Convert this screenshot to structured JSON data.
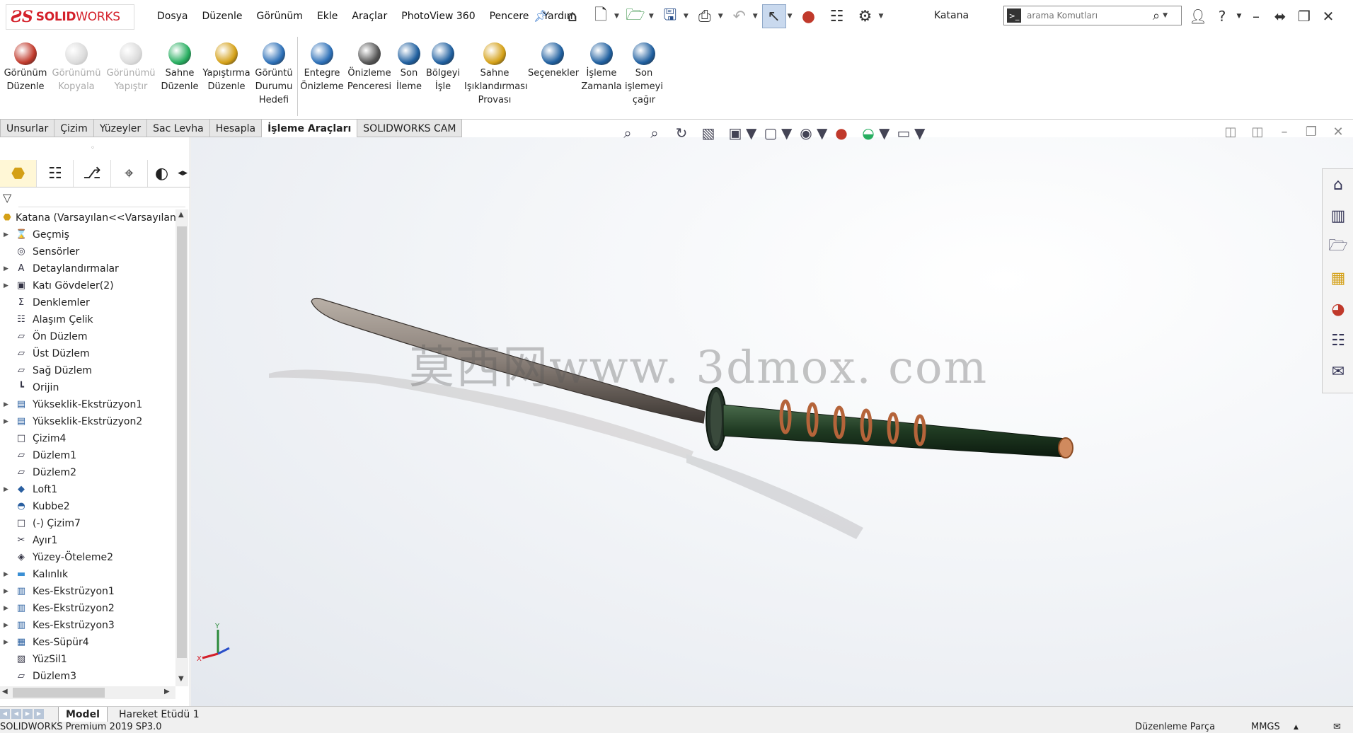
{
  "app": {
    "logo_ds": "ƧS",
    "logo_solid": "SOLID",
    "logo_works": "WORKS",
    "document_title": "Katana"
  },
  "menu": [
    "Dosya",
    "Düzenle",
    "Görünüm",
    "Ekle",
    "Araçlar",
    "PhotoView 360",
    "Pencere",
    "Yardım"
  ],
  "search": {
    "placeholder": "arama Komutları"
  },
  "commands": [
    {
      "label": "Görünüm\nDüzenle",
      "enabled": true,
      "color": "#c0392b"
    },
    {
      "label": "Görünümü\nKopyala",
      "enabled": false,
      "color": "#999999"
    },
    {
      "label": "Görünümü\nYapıştır",
      "enabled": false,
      "color": "#999999"
    },
    {
      "label": "Sahne\nDüzenle",
      "enabled": true,
      "color": "#27ae60"
    },
    {
      "label": "Yapıştırma\nDüzenle",
      "enabled": true,
      "color": "#d4a017"
    },
    {
      "label": "Görüntü\nDurumu\nHedefi",
      "enabled": true,
      "color": "#2c6fb7"
    },
    {
      "label": "Entegre\nÖnizleme",
      "enabled": true,
      "color": "#2c6fb7"
    },
    {
      "label": "Önizleme\nPenceresi",
      "enabled": true,
      "color": "#555555"
    },
    {
      "label": "Son\nİleme",
      "enabled": true,
      "color": "#1f5f9f"
    },
    {
      "label": "Bölgeyi\nİşle",
      "enabled": true,
      "color": "#1f5f9f"
    },
    {
      "label": "Sahne\nIşıklandırması\nProvası",
      "enabled": true,
      "color": "#d4a017"
    },
    {
      "label": "Seçenekler",
      "enabled": true,
      "color": "#1f5f9f"
    },
    {
      "label": "İşleme\nZamanla",
      "enabled": true,
      "color": "#1f5f9f"
    },
    {
      "label": "Son\nişlemeyi\nçağır",
      "enabled": true,
      "color": "#1f5f9f"
    }
  ],
  "tabs": [
    {
      "label": "Unsurlar",
      "active": false
    },
    {
      "label": "Çizim",
      "active": false
    },
    {
      "label": "Yüzeyler",
      "active": false
    },
    {
      "label": "Sac Levha",
      "active": false
    },
    {
      "label": "Hesapla",
      "active": false
    },
    {
      "label": "İşleme Araçları",
      "active": true
    },
    {
      "label": "SOLIDWORKS CAM",
      "active": false
    }
  ],
  "tree": {
    "root": "Katana  (Varsayılan<<Varsayılan>",
    "items": [
      {
        "label": "Geçmiş",
        "expandable": true,
        "icon": "history-icon"
      },
      {
        "label": "Sensörler",
        "expandable": false,
        "icon": "sensor-icon"
      },
      {
        "label": "Detaylandırmalar",
        "expandable": true,
        "icon": "annotation-icon"
      },
      {
        "label": "Katı Gövdeler(2)",
        "expandable": true,
        "icon": "solid-bodies-icon"
      },
      {
        "label": "Denklemler",
        "expandable": false,
        "icon": "equations-icon"
      },
      {
        "label": "Alaşım Çelik",
        "expandable": false,
        "icon": "material-icon"
      },
      {
        "label": "Ön Düzlem",
        "expandable": false,
        "icon": "plane-icon"
      },
      {
        "label": "Üst Düzlem",
        "expandable": false,
        "icon": "plane-icon"
      },
      {
        "label": "Sağ Düzlem",
        "expandable": false,
        "icon": "plane-icon"
      },
      {
        "label": "Orijin",
        "expandable": false,
        "icon": "origin-icon"
      },
      {
        "label": "Yükseklik-Ekstrüzyon1",
        "expandable": true,
        "icon": "extrude-icon"
      },
      {
        "label": "Yükseklik-Ekstrüzyon2",
        "expandable": true,
        "icon": "extrude-icon"
      },
      {
        "label": "Çizim4",
        "expandable": false,
        "icon": "sketch-icon"
      },
      {
        "label": "Düzlem1",
        "expandable": false,
        "icon": "plane-icon"
      },
      {
        "label": "Düzlem2",
        "expandable": false,
        "icon": "plane-icon"
      },
      {
        "label": "Loft1",
        "expandable": true,
        "icon": "loft-icon"
      },
      {
        "label": "Kubbe2",
        "expandable": false,
        "icon": "dome-icon"
      },
      {
        "label": "(-) Çizim7",
        "expandable": false,
        "icon": "sketch-icon"
      },
      {
        "label": "Ayır1",
        "expandable": false,
        "icon": "split-icon"
      },
      {
        "label": "Yüzey-Öteleme2",
        "expandable": false,
        "icon": "surface-offset-icon"
      },
      {
        "label": "Kalınlık",
        "expandable": true,
        "icon": "folder-icon"
      },
      {
        "label": "Kes-Ekstrüzyon1",
        "expandable": true,
        "icon": "cut-extrude-icon"
      },
      {
        "label": "Kes-Ekstrüzyon2",
        "expandable": true,
        "icon": "cut-extrude-icon"
      },
      {
        "label": "Kes-Ekstrüzyon3",
        "expandable": true,
        "icon": "cut-extrude-icon"
      },
      {
        "label": "Kes-Süpür4",
        "expandable": true,
        "icon": "cut-sweep-icon"
      },
      {
        "label": "YüzSil1",
        "expandable": false,
        "icon": "delete-face-icon"
      },
      {
        "label": "Düzlem3",
        "expandable": false,
        "icon": "plane-icon"
      }
    ]
  },
  "viewport": {
    "watermark": "莫西网www. 3dmox. com",
    "triad_y": "Y",
    "triad_x": "X"
  },
  "bottom_tabs": [
    {
      "label": "Model",
      "active": true
    },
    {
      "label": "Hareket Etüdü 1",
      "active": false
    }
  ],
  "status": {
    "left": "SOLIDWORKS Premium 2019 SP3.0",
    "mode": "Düzenleme Parça",
    "units": "MMGS"
  },
  "colors": {
    "brand_red": "#d4202a",
    "blade": "#8a8079",
    "handle": "#1f3a22",
    "wrap": "#b5643a"
  }
}
